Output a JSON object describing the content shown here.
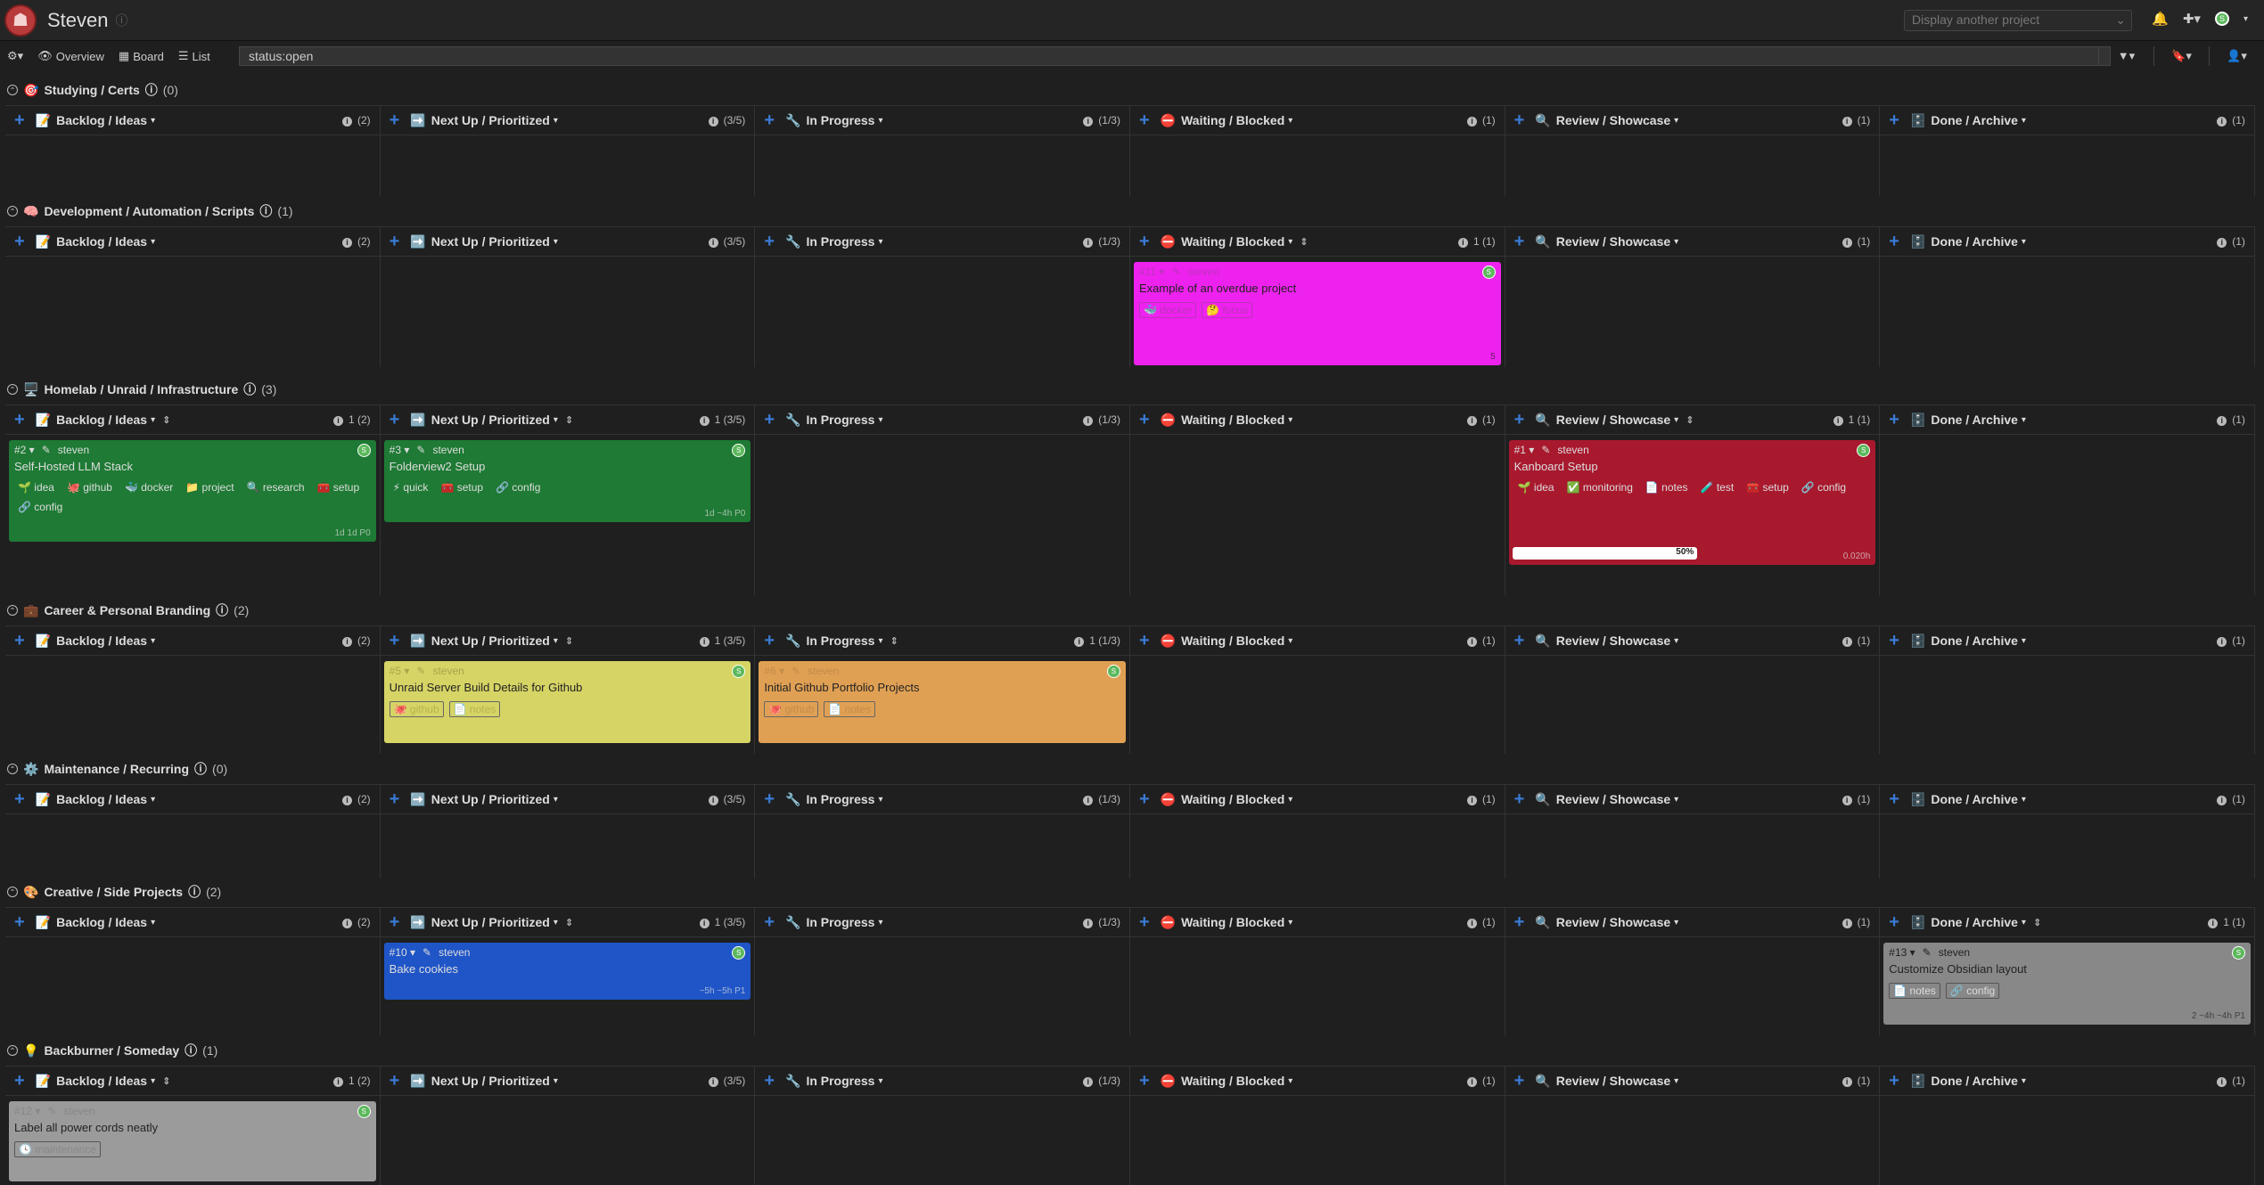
{
  "app": {
    "project_title": "Steven",
    "project_select_placeholder": "Display another project",
    "filter_query": "status:open",
    "nav": {
      "overview": "Overview",
      "board": "Board",
      "list": "List"
    }
  },
  "columns": [
    {
      "emoji": "📝",
      "label": "Backlog / Ideas"
    },
    {
      "emoji": "➡️",
      "label": "Next Up / Prioritized"
    },
    {
      "emoji": "🔧",
      "label": "In Progress"
    },
    {
      "emoji": "⛔",
      "label": "Waiting / Blocked"
    },
    {
      "emoji": "🔍",
      "label": "Review / Showcase"
    },
    {
      "emoji": "🗄️",
      "label": "Done / Archive"
    }
  ],
  "swimlanes": [
    {
      "emoji": "🎯",
      "title": "Studying / Certs",
      "count": "(0)",
      "col_info": [
        "(2)",
        "(3/5)",
        "(1/3)",
        "(1)",
        "(1)",
        "(1)"
      ]
    },
    {
      "emoji": "🧠",
      "title": "Development / Automation / Scripts",
      "count": "(1)",
      "col_info": [
        "(2)",
        "(3/5)",
        "(1/3)",
        "1 (1)",
        "(1)",
        "(1)"
      ]
    },
    {
      "emoji": "🖥️",
      "title": "Homelab / Unraid / Infrastructure",
      "count": "(3)",
      "col_info": [
        "1 (2)",
        "1 (3/5)",
        "(1/3)",
        "(1)",
        "1 (1)",
        "(1)"
      ]
    },
    {
      "emoji": "💼",
      "title": "Career & Personal Branding",
      "count": "(2)",
      "col_info": [
        "(2)",
        "1 (3/5)",
        "1 (1/3)",
        "(1)",
        "(1)",
        "(1)"
      ]
    },
    {
      "emoji": "⚙️",
      "title": "Maintenance / Recurring",
      "count": "(0)",
      "col_info": [
        "(2)",
        "(3/5)",
        "(1/3)",
        "(1)",
        "(1)",
        "(1)"
      ]
    },
    {
      "emoji": "🎨",
      "title": "Creative / Side Projects",
      "count": "(2)",
      "col_info": [
        "(2)",
        "1 (3/5)",
        "(1/3)",
        "(1)",
        "(1)",
        "1 (1)"
      ]
    },
    {
      "emoji": "💡",
      "title": "Backburner / Someday",
      "count": "(1)",
      "col_info": [
        "1 (2)",
        "(3/5)",
        "(1/3)",
        "(1)",
        "(1)",
        "(1)"
      ]
    }
  ],
  "cards": [
    {
      "lane": 1,
      "col": 3,
      "id": "#11",
      "owner": "steven",
      "title": "Example of an overdue project",
      "color": "magenta",
      "tags": [
        "🐳 docker",
        "🤔 focus"
      ],
      "foot": "5"
    },
    {
      "lane": 2,
      "col": 0,
      "id": "#2",
      "owner": "steven",
      "title": "Self-Hosted LLM Stack",
      "color": "green",
      "tags": [
        "🌱 idea",
        "🐙 github",
        "🐳 docker",
        "📁 project",
        "🔍 research",
        "🧰 setup",
        "🔗 config"
      ],
      "foot": "1d 1d P0"
    },
    {
      "lane": 2,
      "col": 1,
      "id": "#3",
      "owner": "steven",
      "title": "Folderview2 Setup",
      "color": "green",
      "tags": [
        "⚡ quick",
        "🧰 setup",
        "🔗 config"
      ],
      "foot": "1d ~4h P0"
    },
    {
      "lane": 2,
      "col": 4,
      "id": "#1",
      "owner": "steven",
      "title": "Kanboard Setup",
      "color": "red",
      "tags": [
        "🌱 idea",
        "✅ monitoring",
        "📄 notes",
        "🧪 test",
        "🧰 setup",
        "🔗 config"
      ],
      "foot": "0.020h",
      "progress": "50%"
    },
    {
      "lane": 3,
      "col": 1,
      "id": "#5",
      "owner": "steven",
      "title": "Unraid Server Build Details for Github",
      "color": "yellow",
      "tags": [
        "🐙 github",
        "📄 notes"
      ],
      "foot": ""
    },
    {
      "lane": 3,
      "col": 2,
      "id": "#6",
      "owner": "steven",
      "title": "Initial Github Portfolio Projects",
      "color": "orange",
      "tags": [
        "🐙 github",
        "📄 notes"
      ],
      "foot": ""
    },
    {
      "lane": 5,
      "col": 1,
      "id": "#10",
      "owner": "steven",
      "title": "Bake cookies",
      "color": "blue",
      "tags": [],
      "foot": "~5h ~5h P1"
    },
    {
      "lane": 5,
      "col": 5,
      "id": "#13",
      "owner": "steven",
      "title": "Customize Obsidian layout",
      "color": "gray",
      "tags": [
        "📄 notes",
        "🔗 config"
      ],
      "foot": "2 ~4h ~4h P1"
    },
    {
      "lane": 6,
      "col": 0,
      "id": "#12",
      "owner": "steven",
      "title": "Label all power cords neatly",
      "color": "lightgray",
      "tags": [
        "🕓 maintenance"
      ],
      "foot": ""
    }
  ]
}
